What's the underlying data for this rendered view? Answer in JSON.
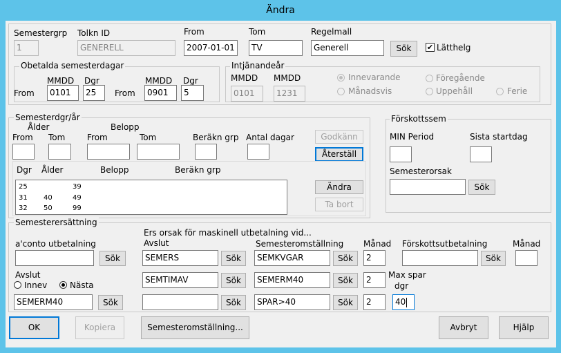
{
  "window": {
    "title": "Ändra"
  },
  "header": {
    "semestergrp_label": "Semestergrp",
    "semestergrp_value": "1",
    "tolknid_label": "Tolkn ID",
    "tolknid_value": "GENERELL",
    "from_label": "From",
    "from_value": "2007-01-01",
    "tom_label": "Tom",
    "tom_value": "TV",
    "regelmall_label": "Regelmall",
    "regelmall_value": "Generell",
    "sok_label": "Sök",
    "latthelg_label": "Lätthelg",
    "latthelg_checked": "✔"
  },
  "obetalda": {
    "title": "Obetalda semesterdagar",
    "mmdd_label": "MMDD",
    "dgr_label": "Dgr",
    "from_label": "From",
    "mmdd1": "0101",
    "dgr1": "25",
    "mmdd2": "0901",
    "dgr2": "5"
  },
  "intjanande": {
    "title": "Intjänandeår",
    "mmdd_label": "MMDD",
    "from_value": "0101",
    "to_value": "1231",
    "innevarande": "Innevarande",
    "foregaende": "Föregående",
    "manadsvis": "Månadsvis",
    "uppehall": "Uppehåll",
    "ferie": "Ferie"
  },
  "semesterdgr": {
    "title": "Semesterdgr/år",
    "alder_label": "Ålder",
    "belopp_label": "Belopp",
    "from_label": "From",
    "tom_label": "Tom",
    "berakn_label": "Beräkn grp",
    "antal_label": "Antal dagar",
    "godkann": "Godkänn",
    "aterstall": "Återställ",
    "andra": "Ändra",
    "ta_bort": "Ta bort",
    "columns": [
      "Dgr",
      "Ålder",
      "Belopp",
      "Beräkn grp"
    ],
    "rows": [
      {
        "dgr": "25",
        "alder": "",
        "belopp": "39"
      },
      {
        "dgr": "31",
        "alder": "40",
        "belopp": "49"
      },
      {
        "dgr": "32",
        "alder": "50",
        "belopp": "99"
      }
    ]
  },
  "forskott": {
    "title": "Förskottssem",
    "min_period": "MIN Period",
    "sista_startdag": "Sista startdag",
    "semesterorsak": "Semesterorsak",
    "sok": "Sök"
  },
  "ersattning": {
    "title": "Semesterersättning",
    "ers_orsak": "Ers orsak för maskinell utbetalning vid...",
    "aconto": "a'conto utbetalning",
    "avslut_col": "Avslut",
    "semomst_col": "Semesteromställning",
    "manad_col": "Månad",
    "forskottsutb_col": "Förskottsutbetalning",
    "manad2_col": "Månad",
    "avslut_label": "Avslut",
    "innev": "Innev",
    "nasta": "Nästa",
    "max_spar": "Max spar",
    "max_dgr": "dgr",
    "sok": "Sök",
    "avslut_val": "SEMERM40",
    "row1_avslut": "SEMERS",
    "row1_semomst": "SEMKVGAR",
    "row1_manad": "2",
    "row2_avslut": "SEMTIMAV",
    "row2_semomst": "SEMERM40",
    "row2_manad": "2",
    "row3_avslut": "",
    "row3_semomst": "SPAR>40",
    "row3_manad": "2",
    "max_spar_value": "40"
  },
  "footer": {
    "ok": "OK",
    "kopiera": "Kopiera",
    "semomst": "Semesteromställning...",
    "avbryt": "Avbryt",
    "hjalp": "Hjälp"
  }
}
